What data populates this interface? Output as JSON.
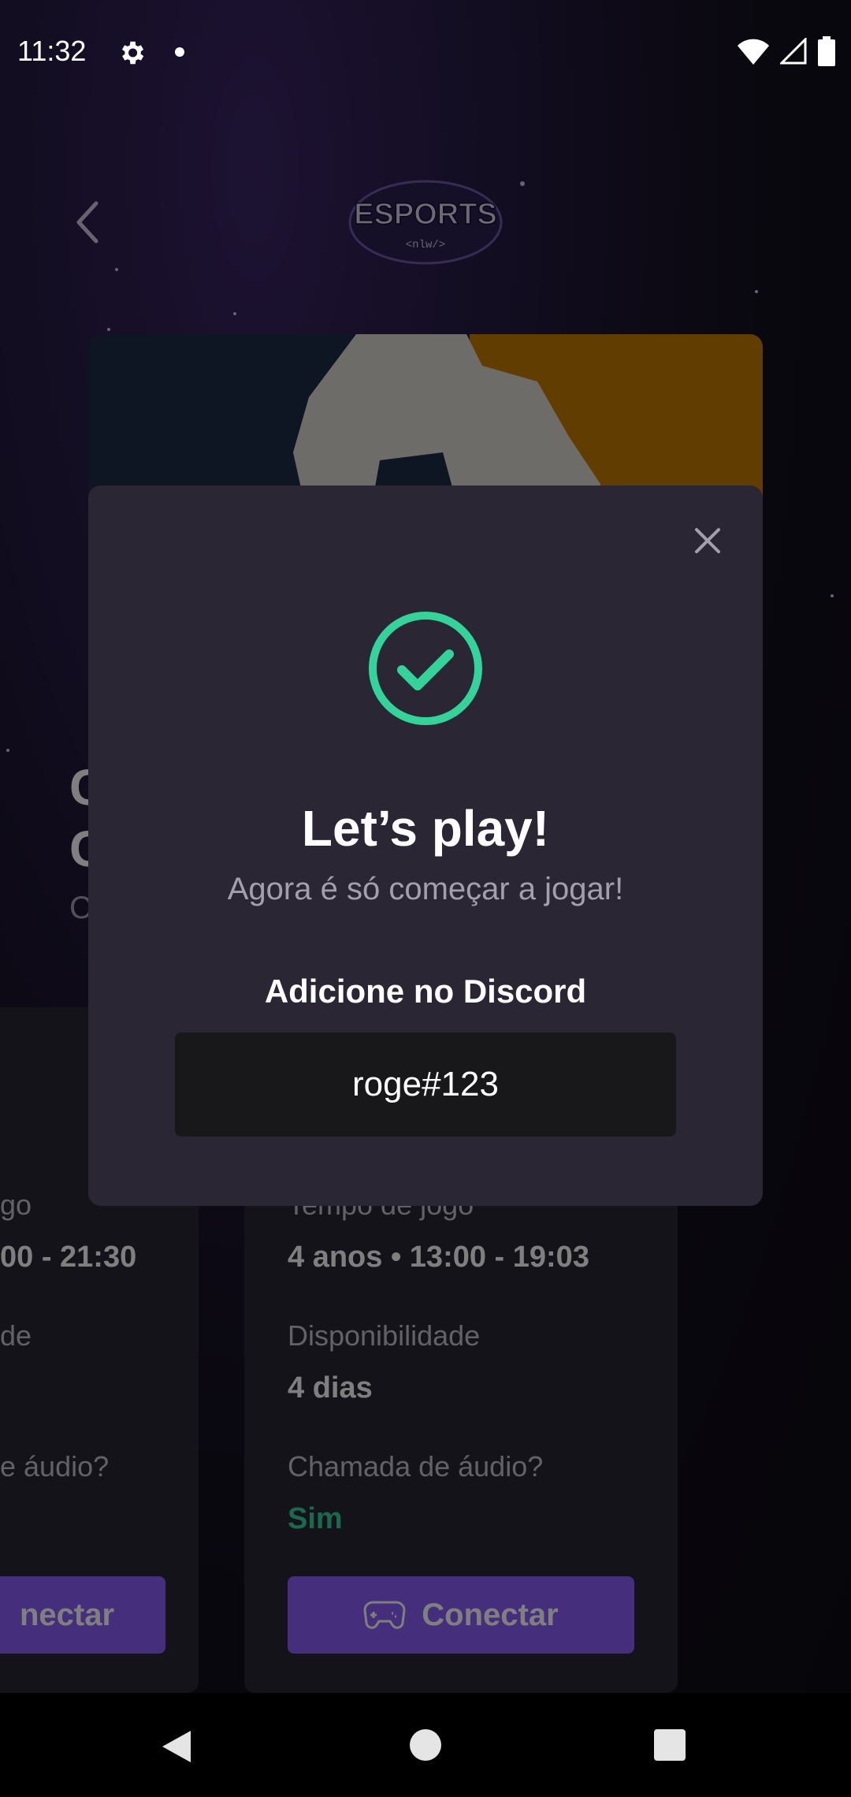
{
  "status_bar": {
    "time": "11:32"
  },
  "logo": {
    "main": "ESPORTS",
    "sub": "<nlw/>"
  },
  "background": {
    "title_line1": "C",
    "title_line2": "C",
    "subtitle": "C"
  },
  "cards": {
    "left": {
      "time_label": "go",
      "time_value": "00 - 21:30",
      "availability_label": "de",
      "audio_label": "e áudio?",
      "connect_label": "nectar"
    },
    "right": {
      "time_label": "Tempo de jogo",
      "time_value": "4 anos • 13:00 - 19:03",
      "availability_label": "Disponibilidade",
      "availability_value": "4 dias",
      "audio_label": "Chamada de áudio?",
      "audio_value": "Sim",
      "connect_label": "Conectar"
    }
  },
  "modal": {
    "title": "Let’s play!",
    "subtitle": "Agora é só começar a jogar!",
    "discord_label": "Adicione no Discord",
    "discord_value": "roge#123"
  },
  "colors": {
    "accent": "#8b5cf6",
    "success": "#34d399",
    "modal_bg": "#2a2634"
  }
}
